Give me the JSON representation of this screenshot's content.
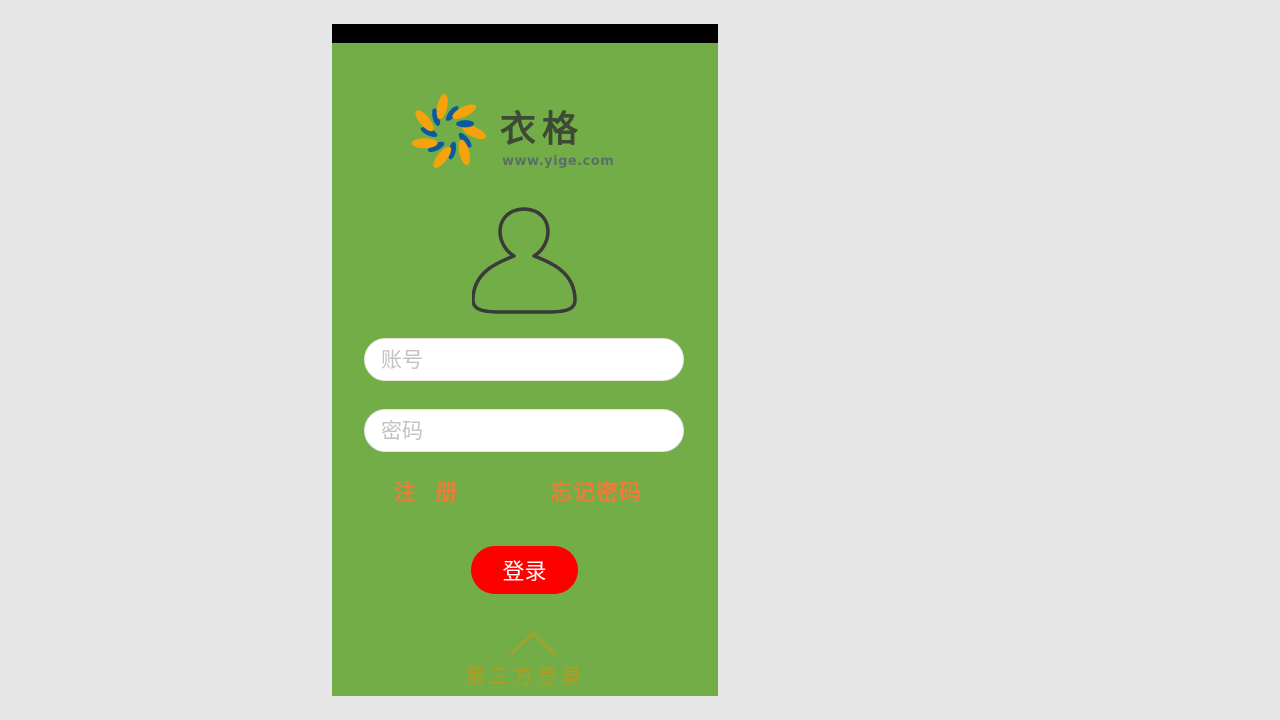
{
  "brand": {
    "name": "衣格",
    "url": "www.yige.com",
    "logo_icon": "sunburst-logo-icon",
    "logo_colors": [
      "#f5a20b",
      "#0b5aa0"
    ]
  },
  "avatar": {
    "icon": "user-avatar-icon"
  },
  "login_form": {
    "account_placeholder": "账号",
    "account_value": "",
    "password_placeholder": "密码",
    "password_value": ""
  },
  "links": {
    "register": "注 册",
    "forgot_password": "忘记密码"
  },
  "login_button": {
    "label": "登录"
  },
  "third_party": {
    "icon": "chevron-up-icon",
    "label": "第三方登录"
  },
  "colors": {
    "page_background": "#e6e6e6",
    "screen_background": "#73ad47",
    "status_bar": "#000000",
    "link_text": "#f07a39",
    "login_button": "#ff0000",
    "third_party_text": "#b59c21"
  }
}
